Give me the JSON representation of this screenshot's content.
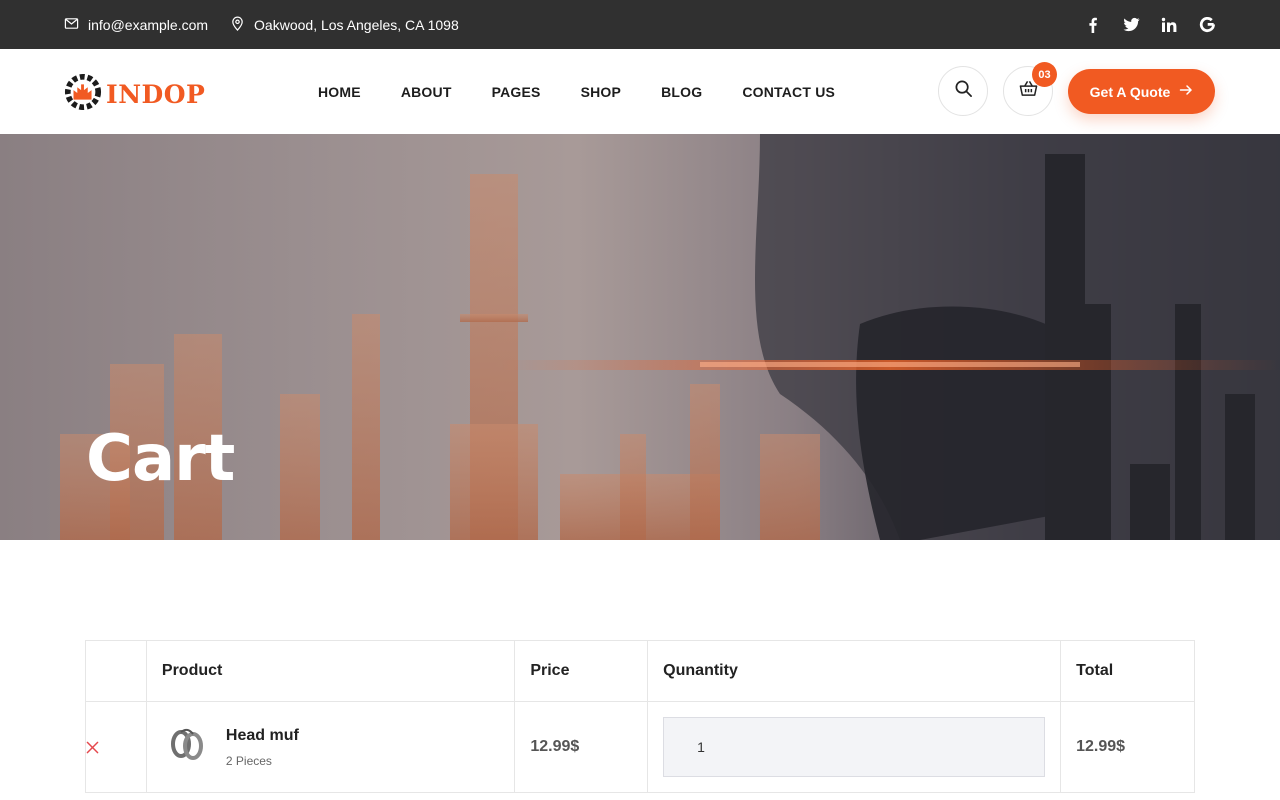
{
  "topbar": {
    "email": "info@example.com",
    "address": "Oakwood, Los Angeles, CA 1098",
    "social": [
      "facebook-icon",
      "twitter-icon",
      "linkedin-icon",
      "google-icon"
    ]
  },
  "header": {
    "logo_text": "INDOP",
    "nav": [
      "HOME",
      "ABOUT",
      "PAGES",
      "SHOP",
      "BLOG",
      "CONTACT US"
    ],
    "cart_count": "03",
    "quote_label": "Get A Quote"
  },
  "hero": {
    "title": "Cart"
  },
  "cart": {
    "headers": {
      "product": "Product",
      "price": "Price",
      "quantity": "Qunantity",
      "total": "Total"
    },
    "rows": [
      {
        "name": "Head muf",
        "pieces": "2 Pieces",
        "price": "12.99$",
        "quantity": "1",
        "total": "12.99$"
      }
    ]
  },
  "colors": {
    "accent": "#f15a22",
    "topbar": "#303030",
    "remove": "#e5484d"
  }
}
